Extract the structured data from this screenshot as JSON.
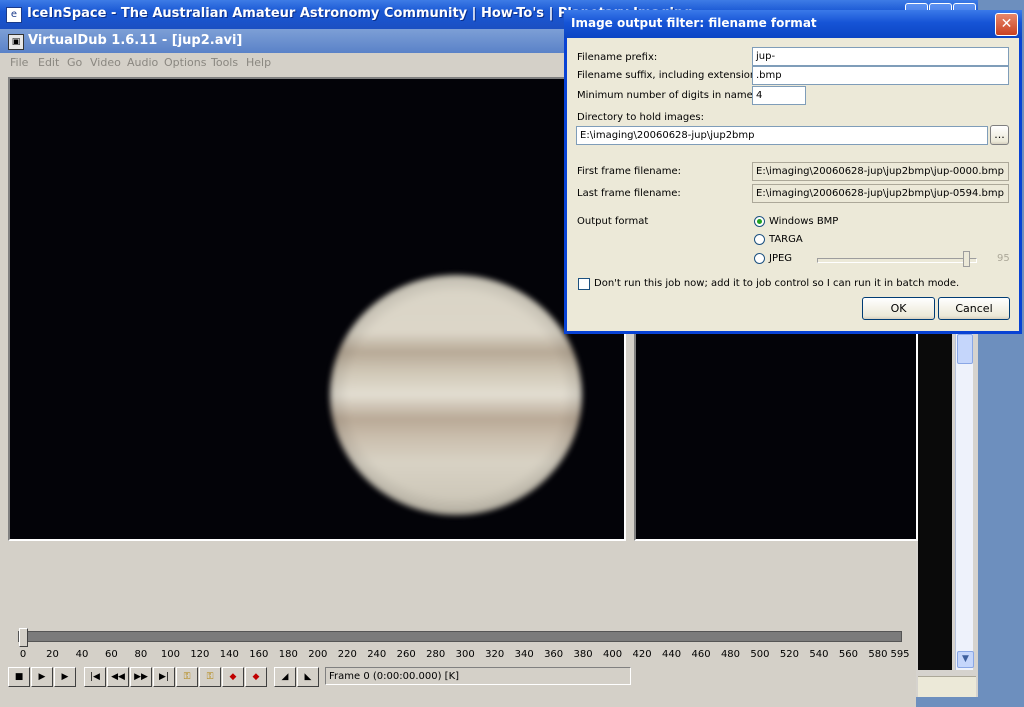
{
  "browser": {
    "title": "IceInSpace - The Australian Amateur Astronomy Community | How-To's | Planetary Imaging"
  },
  "virtualdub": {
    "title": "VirtualDub 1.6.11 - [jup2.avi]",
    "menu": [
      "File",
      "Edit",
      "Go",
      "Video",
      "Audio",
      "Options",
      "Tools",
      "Help"
    ],
    "timeline_ticks": [
      "0",
      "20",
      "40",
      "60",
      "80",
      "100",
      "120",
      "140",
      "160",
      "180",
      "200",
      "220",
      "240",
      "260",
      "280",
      "300",
      "320",
      "340",
      "360",
      "380",
      "400",
      "420",
      "440",
      "460",
      "480",
      "500",
      "520",
      "540",
      "560",
      "580",
      "595"
    ],
    "frame_status": "Frame 0 (0:00:00.000) [K]",
    "position_fraction": 0
  },
  "dialog": {
    "title": "Image output filter: filename format",
    "close_label": "✕",
    "prefix_label": "Filename prefix:",
    "prefix_value": "jup-",
    "suffix_label": "Filename suffix, including extension:",
    "suffix_value": ".bmp",
    "digits_label": "Minimum number of digits in name:",
    "digits_value": "4",
    "dir_label": "Directory to hold images:",
    "dir_value": "E:\\imaging\\20060628-jup\\jup2bmp",
    "browse_label": "...",
    "first_label": "First frame filename:",
    "first_value": "E:\\imaging\\20060628-jup\\jup2bmp\\jup-0000.bmp",
    "last_label": "Last frame filename:",
    "last_value": "E:\\imaging\\20060628-jup\\jup2bmp\\jup-0594.bmp",
    "format_label": "Output format",
    "format_options": [
      "Windows BMP",
      "TARGA",
      "JPEG"
    ],
    "selected_format": "Windows BMP",
    "jpeg_quality": "95",
    "batch_label": "Don't run this job now; add it to job control so I can run it in batch mode.",
    "batch_checked": false,
    "ok_label": "OK",
    "cancel_label": "Cancel"
  }
}
